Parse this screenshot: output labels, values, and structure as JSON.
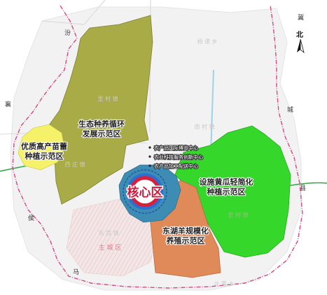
{
  "colors": {
    "ecological_zone": "#a9ac46",
    "seedling_zone": "#f5f26a",
    "cucumber_zone": "#35d82a",
    "sheep_zone": "#e08a5a",
    "core_zone": "#3d8cb4",
    "core_label": "#d4143a",
    "county_line": "#d34a86",
    "river": "#9fd3e8",
    "highway": "#2fa84a"
  },
  "north_arrow": {
    "label": "北",
    "icon": "north-arrow-icon"
  },
  "zones": {
    "ecological": "生态种养循环\n发展示范区",
    "seedling": "优质高产苗蕾\n种植示范区",
    "cucumber": "设施黄瓜轻简化\n种植示范区",
    "sheep": "东湖羊规模化\n养殖示范区",
    "core": "核心区"
  },
  "facilities": [
    "农产品国际博览中心",
    "农业科技服务创新中心",
    "农产品加工配送中心"
  ],
  "towns": {
    "yangyu": "杨 谡 乡",
    "lichen": "里 村 镇",
    "nancun": "南 村 镇",
    "xizhuang": "西 庄 镇",
    "shicun": "史 村 镇",
    "dongzhuang": "东 宫 镇",
    "zhucheng": "主 城 区",
    "beidong": "北 董 乡"
  },
  "edge_labels": {
    "ji": "冀",
    "cheng": "城",
    "xiang": "襄",
    "fen": "汾",
    "hou": "侯",
    "xian": "县",
    "ma": "马"
  }
}
